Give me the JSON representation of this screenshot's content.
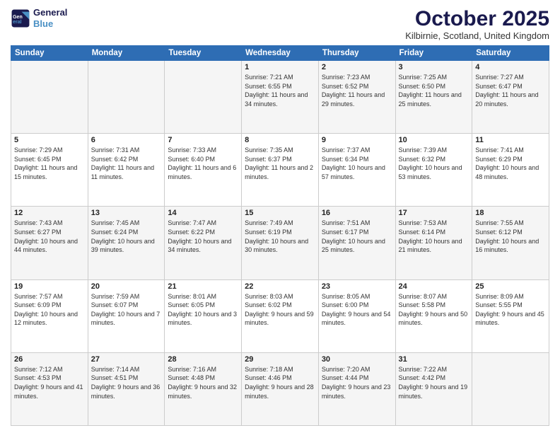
{
  "logo": {
    "line1": "General",
    "line2": "Blue"
  },
  "header": {
    "title": "October 2025",
    "subtitle": "Kilbirnie, Scotland, United Kingdom"
  },
  "columns": [
    "Sunday",
    "Monday",
    "Tuesday",
    "Wednesday",
    "Thursday",
    "Friday",
    "Saturday"
  ],
  "weeks": [
    [
      {
        "date": "",
        "info": ""
      },
      {
        "date": "",
        "info": ""
      },
      {
        "date": "",
        "info": ""
      },
      {
        "date": "1",
        "info": "Sunrise: 7:21 AM\nSunset: 6:55 PM\nDaylight: 11 hours and 34 minutes."
      },
      {
        "date": "2",
        "info": "Sunrise: 7:23 AM\nSunset: 6:52 PM\nDaylight: 11 hours and 29 minutes."
      },
      {
        "date": "3",
        "info": "Sunrise: 7:25 AM\nSunset: 6:50 PM\nDaylight: 11 hours and 25 minutes."
      },
      {
        "date": "4",
        "info": "Sunrise: 7:27 AM\nSunset: 6:47 PM\nDaylight: 11 hours and 20 minutes."
      }
    ],
    [
      {
        "date": "5",
        "info": "Sunrise: 7:29 AM\nSunset: 6:45 PM\nDaylight: 11 hours and 15 minutes."
      },
      {
        "date": "6",
        "info": "Sunrise: 7:31 AM\nSunset: 6:42 PM\nDaylight: 11 hours and 11 minutes."
      },
      {
        "date": "7",
        "info": "Sunrise: 7:33 AM\nSunset: 6:40 PM\nDaylight: 11 hours and 6 minutes."
      },
      {
        "date": "8",
        "info": "Sunrise: 7:35 AM\nSunset: 6:37 PM\nDaylight: 11 hours and 2 minutes."
      },
      {
        "date": "9",
        "info": "Sunrise: 7:37 AM\nSunset: 6:34 PM\nDaylight: 10 hours and 57 minutes."
      },
      {
        "date": "10",
        "info": "Sunrise: 7:39 AM\nSunset: 6:32 PM\nDaylight: 10 hours and 53 minutes."
      },
      {
        "date": "11",
        "info": "Sunrise: 7:41 AM\nSunset: 6:29 PM\nDaylight: 10 hours and 48 minutes."
      }
    ],
    [
      {
        "date": "12",
        "info": "Sunrise: 7:43 AM\nSunset: 6:27 PM\nDaylight: 10 hours and 44 minutes."
      },
      {
        "date": "13",
        "info": "Sunrise: 7:45 AM\nSunset: 6:24 PM\nDaylight: 10 hours and 39 minutes."
      },
      {
        "date": "14",
        "info": "Sunrise: 7:47 AM\nSunset: 6:22 PM\nDaylight: 10 hours and 34 minutes."
      },
      {
        "date": "15",
        "info": "Sunrise: 7:49 AM\nSunset: 6:19 PM\nDaylight: 10 hours and 30 minutes."
      },
      {
        "date": "16",
        "info": "Sunrise: 7:51 AM\nSunset: 6:17 PM\nDaylight: 10 hours and 25 minutes."
      },
      {
        "date": "17",
        "info": "Sunrise: 7:53 AM\nSunset: 6:14 PM\nDaylight: 10 hours and 21 minutes."
      },
      {
        "date": "18",
        "info": "Sunrise: 7:55 AM\nSunset: 6:12 PM\nDaylight: 10 hours and 16 minutes."
      }
    ],
    [
      {
        "date": "19",
        "info": "Sunrise: 7:57 AM\nSunset: 6:09 PM\nDaylight: 10 hours and 12 minutes."
      },
      {
        "date": "20",
        "info": "Sunrise: 7:59 AM\nSunset: 6:07 PM\nDaylight: 10 hours and 7 minutes."
      },
      {
        "date": "21",
        "info": "Sunrise: 8:01 AM\nSunset: 6:05 PM\nDaylight: 10 hours and 3 minutes."
      },
      {
        "date": "22",
        "info": "Sunrise: 8:03 AM\nSunset: 6:02 PM\nDaylight: 9 hours and 59 minutes."
      },
      {
        "date": "23",
        "info": "Sunrise: 8:05 AM\nSunset: 6:00 PM\nDaylight: 9 hours and 54 minutes."
      },
      {
        "date": "24",
        "info": "Sunrise: 8:07 AM\nSunset: 5:58 PM\nDaylight: 9 hours and 50 minutes."
      },
      {
        "date": "25",
        "info": "Sunrise: 8:09 AM\nSunset: 5:55 PM\nDaylight: 9 hours and 45 minutes."
      }
    ],
    [
      {
        "date": "26",
        "info": "Sunrise: 7:12 AM\nSunset: 4:53 PM\nDaylight: 9 hours and 41 minutes."
      },
      {
        "date": "27",
        "info": "Sunrise: 7:14 AM\nSunset: 4:51 PM\nDaylight: 9 hours and 36 minutes."
      },
      {
        "date": "28",
        "info": "Sunrise: 7:16 AM\nSunset: 4:48 PM\nDaylight: 9 hours and 32 minutes."
      },
      {
        "date": "29",
        "info": "Sunrise: 7:18 AM\nSunset: 4:46 PM\nDaylight: 9 hours and 28 minutes."
      },
      {
        "date": "30",
        "info": "Sunrise: 7:20 AM\nSunset: 4:44 PM\nDaylight: 9 hours and 23 minutes."
      },
      {
        "date": "31",
        "info": "Sunrise: 7:22 AM\nSunset: 4:42 PM\nDaylight: 9 hours and 19 minutes."
      },
      {
        "date": "",
        "info": ""
      }
    ]
  ]
}
